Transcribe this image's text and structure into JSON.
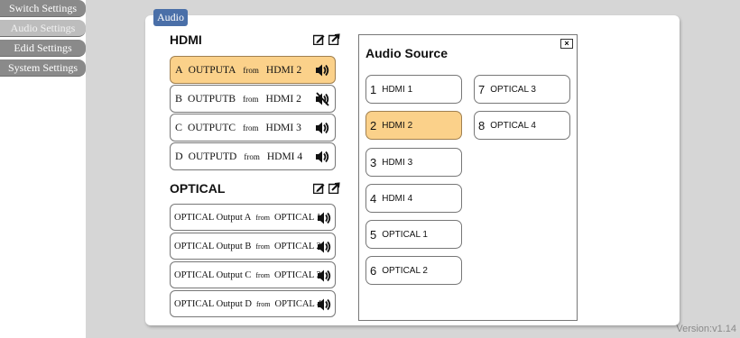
{
  "sidebar": {
    "items": [
      {
        "label": "Switch Settings"
      },
      {
        "label": "Audio Settings"
      },
      {
        "label": "Edid Settings"
      },
      {
        "label": "System Settings"
      }
    ]
  },
  "tab": {
    "label": "Audio"
  },
  "hdmi": {
    "title": "HDMI",
    "from_word": "from",
    "outputs": [
      {
        "letter": "A",
        "name": "OUTPUTA",
        "source": "HDMI 2",
        "muted": false,
        "selected": true
      },
      {
        "letter": "B",
        "name": "OUTPUTB",
        "source": "HDMI 2",
        "muted": true,
        "selected": false
      },
      {
        "letter": "C",
        "name": "OUTPUTC",
        "source": "HDMI 3",
        "muted": false,
        "selected": false
      },
      {
        "letter": "D",
        "name": "OUTPUTD",
        "source": "HDMI 4",
        "muted": false,
        "selected": false
      }
    ]
  },
  "optical": {
    "title": "OPTICAL",
    "from_word": "from",
    "outputs": [
      {
        "name": "OPTICAL Output A",
        "source": "OPTICAL 1"
      },
      {
        "name": "OPTICAL Output B",
        "source": "OPTICAL 2"
      },
      {
        "name": "OPTICAL Output C",
        "source": "OPTICAL 3"
      },
      {
        "name": "OPTICAL Output D",
        "source": "OPTICAL 4"
      }
    ]
  },
  "audio_source": {
    "title": "Audio Source",
    "close_symbol": "×",
    "sources": [
      {
        "num": "1",
        "name": "HDMI 1",
        "selected": false
      },
      {
        "num": "2",
        "name": "HDMI 2",
        "selected": true
      },
      {
        "num": "3",
        "name": "HDMI 3",
        "selected": false
      },
      {
        "num": "4",
        "name": "HDMI 4",
        "selected": false
      },
      {
        "num": "5",
        "name": "OPTICAL 1",
        "selected": false
      },
      {
        "num": "6",
        "name": "OPTICAL 2",
        "selected": false
      },
      {
        "num": "7",
        "name": "OPTICAL 3",
        "selected": false
      },
      {
        "num": "8",
        "name": "OPTICAL 4",
        "selected": false
      }
    ]
  },
  "version": "Version:v1.14",
  "colors": {
    "accent_tab": "#4a6fa8",
    "selected": "#fbd18a",
    "sidebar": "#8a8a8a",
    "background": "#d6d6d6"
  }
}
